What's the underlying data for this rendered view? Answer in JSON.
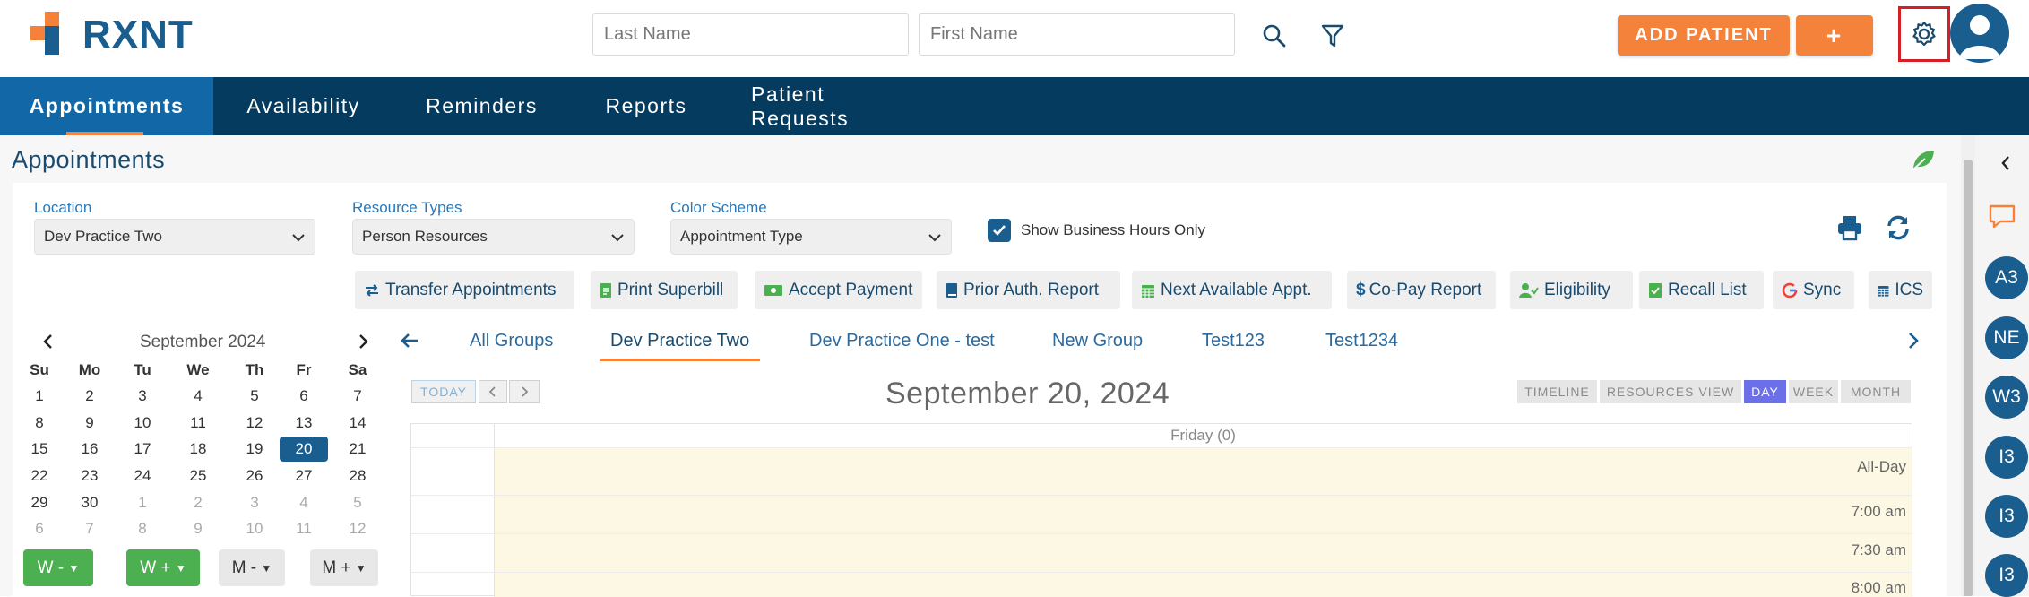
{
  "brand": {
    "name": "RXNT",
    "accent": "#f4823b",
    "primary": "#1a5d8f",
    "nav_bg": "#053b5e"
  },
  "header": {
    "last_name_placeholder": "Last Name",
    "first_name_placeholder": "First Name",
    "add_patient_label": "ADD PATIENT",
    "plus_label": "+",
    "icons": [
      "search-icon",
      "filter-icon",
      "gear-icon",
      "avatar"
    ]
  },
  "nav": {
    "items": [
      {
        "label": "Appointments",
        "active": true
      },
      {
        "label": "Availability"
      },
      {
        "label": "Reminders"
      },
      {
        "label": "Reports"
      },
      {
        "label": "Patient Requests"
      }
    ]
  },
  "page": {
    "title": "Appointments"
  },
  "filters": {
    "location": {
      "label": "Location",
      "value": "Dev Practice Two"
    },
    "resource_types": {
      "label": "Resource Types",
      "value": "Person Resources"
    },
    "color_scheme": {
      "label": "Color Scheme",
      "value": "Appointment Type"
    },
    "business_hours": {
      "label": "Show Business Hours Only",
      "checked": true
    }
  },
  "toolbar": [
    {
      "label": "Transfer Appointments",
      "icon": "transfer-icon"
    },
    {
      "label": "Print Superbill",
      "icon": "document-icon"
    },
    {
      "label": "Accept Payment",
      "icon": "money-icon"
    },
    {
      "label": "Prior Auth. Report",
      "icon": "book-icon"
    },
    {
      "label": "Next Available Appt.",
      "icon": "calendar-icon"
    },
    {
      "label": "Co-Pay Report",
      "icon": "dollar-icon"
    },
    {
      "label": "Eligibility",
      "icon": "user-check-icon"
    },
    {
      "label": "Recall List",
      "icon": "checklist-icon"
    },
    {
      "label": "Sync",
      "icon": "google-icon"
    },
    {
      "label": "ICS",
      "icon": "calendar-icon"
    }
  ],
  "mini_calendar": {
    "month": "September 2024",
    "dow": [
      "Su",
      "Mo",
      "Tu",
      "We",
      "Th",
      "Fr",
      "Sa"
    ],
    "weeks": [
      [
        "1",
        "2",
        "3",
        "4",
        "5",
        "6",
        "7"
      ],
      [
        "8",
        "9",
        "10",
        "11",
        "12",
        "13",
        "14"
      ],
      [
        "15",
        "16",
        "17",
        "18",
        "19",
        "20",
        "21"
      ],
      [
        "22",
        "23",
        "24",
        "25",
        "26",
        "27",
        "28"
      ],
      [
        "29",
        "30",
        "1",
        "2",
        "3",
        "4",
        "5"
      ],
      [
        "6",
        "7",
        "8",
        "9",
        "10",
        "11",
        "12"
      ]
    ],
    "selected": "20",
    "buttons": [
      "W -",
      "W +",
      "M -",
      "M +"
    ]
  },
  "groups": {
    "tabs": [
      "All Groups",
      "Dev Practice Two",
      "Dev Practice One - test",
      "New Group",
      "Test123",
      "Test1234"
    ],
    "active": "Dev Practice Two"
  },
  "scheduler": {
    "today_label": "TODAY",
    "date_title": "September 20, 2024",
    "views": [
      "TIMELINE",
      "RESOURCES VIEW",
      "DAY",
      "WEEK",
      "MONTH"
    ],
    "active_view": "DAY",
    "column_header": "Friday (0)",
    "rows": [
      "All-Day",
      "7:00 am",
      "7:30 am",
      "8:00 am"
    ]
  },
  "right_rail": {
    "badges": [
      "A3",
      "NE",
      "W3",
      "I3",
      "I3",
      "I3"
    ]
  }
}
